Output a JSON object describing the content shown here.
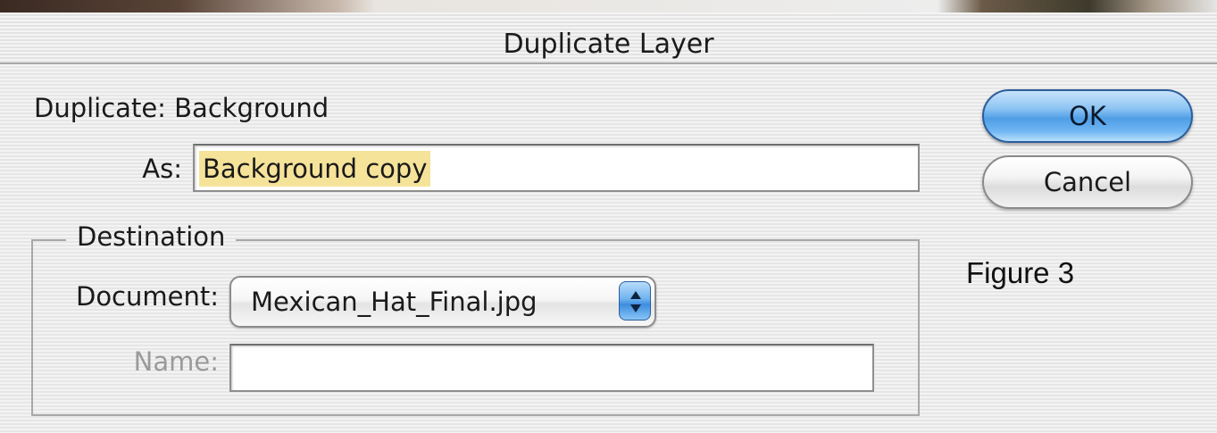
{
  "window": {
    "title": "Duplicate Layer"
  },
  "form": {
    "duplicate_label": "Duplicate: Background",
    "as_label": "As:",
    "as_value": "Background copy"
  },
  "buttons": {
    "ok_label": "OK",
    "cancel_label": "Cancel"
  },
  "destination": {
    "legend": "Destination",
    "document_label": "Document:",
    "document_value": "Mexican_Hat_Final.jpg",
    "name_label": "Name:",
    "name_value": ""
  },
  "caption": "Figure 3",
  "icons": {
    "popup_arrows": "up-down-chevron-icon"
  },
  "colors": {
    "selection_highlight": "#f6e39a",
    "default_button_blue": "#4f9ee6"
  }
}
